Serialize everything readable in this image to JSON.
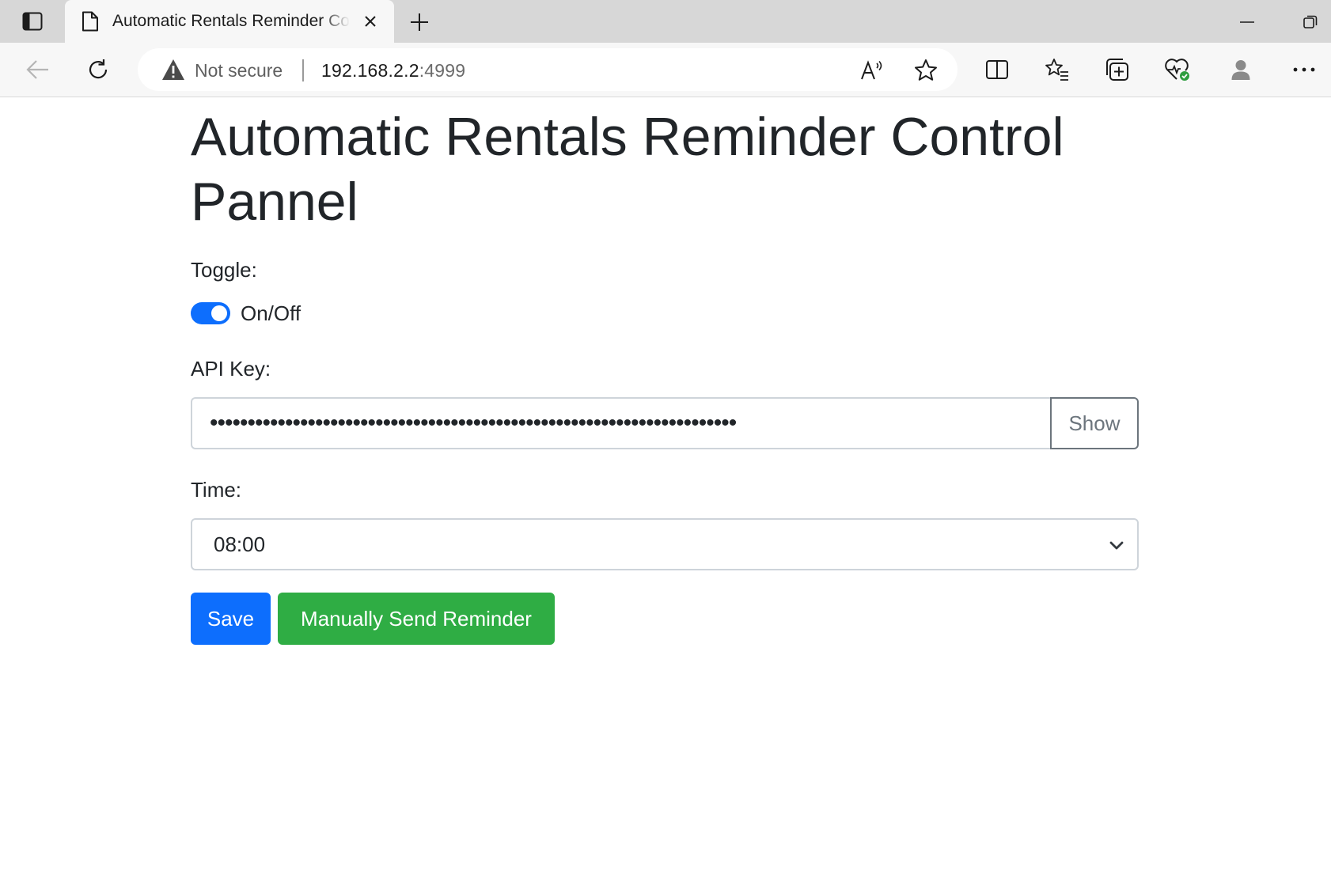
{
  "browser": {
    "tab": {
      "title": "Automatic Rentals Reminder Control Pannel"
    },
    "address": {
      "security_text": "Not secure",
      "host": "192.168.2.2",
      "port": ":4999"
    }
  },
  "page": {
    "title": "Automatic Rentals Reminder Control Pannel",
    "toggle_label": "Toggle:",
    "toggle_text": "On/Off",
    "toggle_on": true,
    "api_key_label": "API Key:",
    "api_key_masked": "••••••••••••••••••••••••••••••••••••••••••••••••••••••••••••••••••••••",
    "show_button": "Show",
    "time_label": "Time:",
    "time_value": "08:00",
    "save_button": "Save",
    "send_button": "Manually Send Reminder"
  },
  "colors": {
    "primary": "#0d6efd",
    "success": "#2fad44"
  }
}
